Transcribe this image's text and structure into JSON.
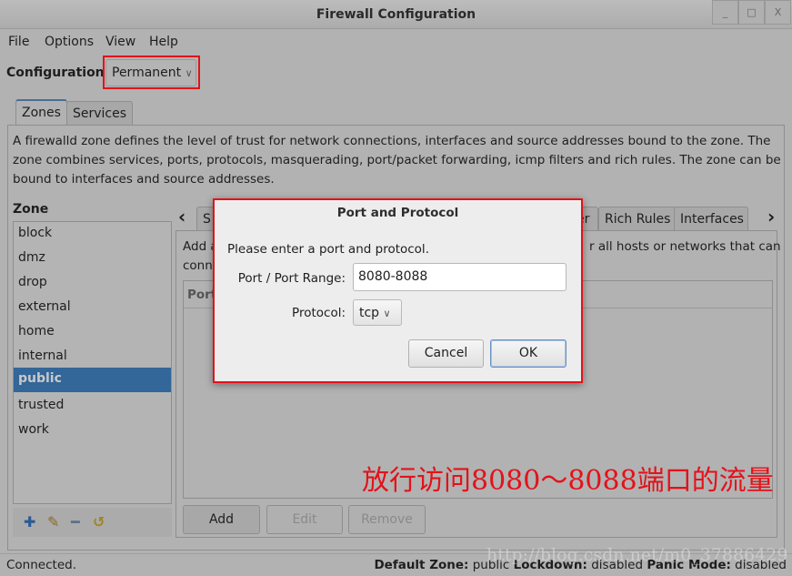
{
  "window": {
    "title": "Firewall Configuration",
    "controls": [
      "_",
      "□",
      "X"
    ]
  },
  "menu": [
    "File",
    "Options",
    "View",
    "Help"
  ],
  "configuration": {
    "label": "Configuration:",
    "value": "Permanent"
  },
  "main_tabs": [
    "Zones",
    "Services"
  ],
  "description": [
    "A firewalld zone defines the level of trust for network connections, interfaces and source addresses bound to the zone. The",
    "zone combines services, ports, protocols, masquerading, port/packet forwarding, icmp filters and rich rules. The zone can be",
    "bound to interfaces and source addresses."
  ],
  "zones": {
    "label": "Zone",
    "items": [
      "block",
      "dmz",
      "drop",
      "external",
      "home",
      "internal",
      "public",
      "trusted",
      "work"
    ],
    "selected": "public"
  },
  "zone_tabs": {
    "partial_left": "S",
    "partial_mid": "er",
    "items": [
      "Rich Rules",
      "Interfaces"
    ]
  },
  "ports_panel": {
    "desc_line1_left": "Add a",
    "desc_line1_right": "r all hosts or networks that can",
    "desc_line2_left": "conn",
    "column": "Port"
  },
  "buttons": {
    "add": "Add",
    "edit": "Edit",
    "remove": "Remove"
  },
  "dialog": {
    "title": "Port and Protocol",
    "prompt": "Please enter a port and protocol.",
    "port_label": "Port / Port Range:",
    "port_value": "8080-8088",
    "protocol_label": "Protocol:",
    "protocol_value": "tcp",
    "cancel": "Cancel",
    "ok": "OK"
  },
  "annotation": "放行访问8080～8088端口的流量",
  "status": {
    "left": "Connected.",
    "default_zone_label": "Default Zone:",
    "default_zone": "public",
    "lockdown_label": "Lockdown:",
    "lockdown": "disabled",
    "panic_label": "Panic Mode:",
    "panic": "disabled"
  },
  "watermark": "http://blog.csdn.net/m0_37886429",
  "colors": {
    "highlight": "#336699",
    "annotation": "#e3121a"
  }
}
